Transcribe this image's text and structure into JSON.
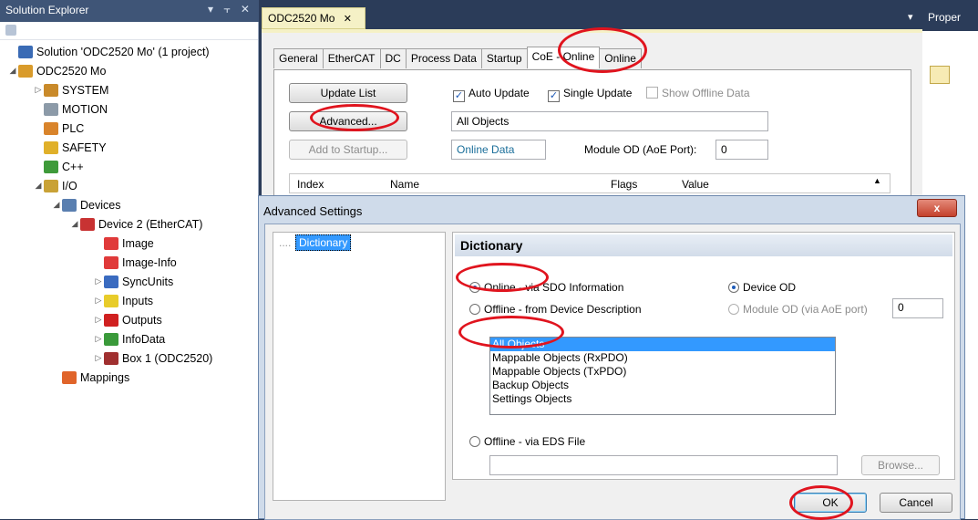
{
  "solution_explorer": {
    "title": "Solution Explorer",
    "controls": "▾ ⫟ ✕",
    "tree": [
      {
        "label": "Solution 'ODC2520 Mo' (1 project)",
        "level": 0,
        "expander": "",
        "icon_color": "#3a6bb5"
      },
      {
        "label": "ODC2520 Mo",
        "level": 0,
        "expander": "◢",
        "icon_color": "#d99b2b"
      },
      {
        "label": "SYSTEM",
        "level": 1,
        "expander": "▷",
        "icon_color": "#c98a2a"
      },
      {
        "label": "MOTION",
        "level": 1,
        "expander": "",
        "icon_color": "#8c9aa8"
      },
      {
        "label": "PLC",
        "level": 1,
        "expander": "",
        "icon_color": "#d9842b"
      },
      {
        "label": "SAFETY",
        "level": 1,
        "expander": "",
        "icon_color": "#e0b02a"
      },
      {
        "label": "C++",
        "level": 1,
        "expander": "",
        "icon_color": "#3f9a3a"
      },
      {
        "label": "I/O",
        "level": 1,
        "expander": "◢",
        "icon_color": "#c9a236"
      },
      {
        "label": "Devices",
        "level": 2,
        "expander": "◢",
        "icon_color": "#5a7fb0"
      },
      {
        "label": "Device 2 (EtherCAT)",
        "level": 3,
        "expander": "◢",
        "icon_color": "#c83232"
      },
      {
        "label": "Image",
        "level": 4,
        "expander": "",
        "icon_color": "#e03a3a"
      },
      {
        "label": "Image-Info",
        "level": 4,
        "expander": "",
        "icon_color": "#e03a3a"
      },
      {
        "label": "SyncUnits",
        "level": 4,
        "expander": "▷",
        "icon_color": "#3a6bc0"
      },
      {
        "label": "Inputs",
        "level": 4,
        "expander": "▷",
        "icon_color": "#e8cc2a"
      },
      {
        "label": "Outputs",
        "level": 4,
        "expander": "▷",
        "icon_color": "#d02020"
      },
      {
        "label": "InfoData",
        "level": 4,
        "expander": "▷",
        "icon_color": "#3a9a3a"
      },
      {
        "label": "Box 1 (ODC2520)",
        "level": 4,
        "expander": "▷",
        "icon_color": "#a03030"
      },
      {
        "label": "Mappings",
        "level": 2,
        "expander": "",
        "icon_color": "#e0642a"
      }
    ]
  },
  "document": {
    "tab_label": "ODC2520 Mo",
    "tab_close": "✕",
    "dropdown_arrow": "▾",
    "tabs": [
      "General",
      "EtherCAT",
      "DC",
      "Process Data",
      "Startup",
      "CoE - Online",
      "Online"
    ],
    "active_tab": "CoE - Online",
    "buttons": {
      "update_list": "Update List",
      "advanced": "Advanced...",
      "add_to_startup": "Add to Startup..."
    },
    "checks": {
      "auto_update": "Auto Update",
      "single_update": "Single Update",
      "show_offline": "Show Offline Data"
    },
    "objects_field": "All Objects",
    "online_data_field": "Online Data",
    "module_od_label": "Module OD (AoE Port):",
    "module_od_value": "0",
    "grid_headers": [
      "Index",
      "Name",
      "Flags",
      "Value"
    ]
  },
  "properties": {
    "title": "Proper"
  },
  "dialog": {
    "title": "Advanced Settings",
    "close": "x",
    "tree_item": "Dictionary",
    "section_title": "Dictionary",
    "radio_online_sdo": "Online - via SDO Information",
    "radio_offline_desc": "Offline - from Device Description",
    "radio_device_od": "Device OD",
    "radio_module_od": "Module OD (via AoE port)",
    "module_od_value": "0",
    "objects": [
      "All Objects",
      "Mappable Objects (RxPDO)",
      "Mappable Objects (TxPDO)",
      "Backup Objects",
      "Settings Objects"
    ],
    "selected_object": "All Objects",
    "radio_offline_eds": "Offline - via EDS File",
    "eds_path": "",
    "browse": "Browse...",
    "ok": "OK",
    "cancel": "Cancel"
  },
  "colors": {
    "highlight": "#e0141e",
    "selection": "#3399ff",
    "doc_tab": "#f5f1c6"
  }
}
